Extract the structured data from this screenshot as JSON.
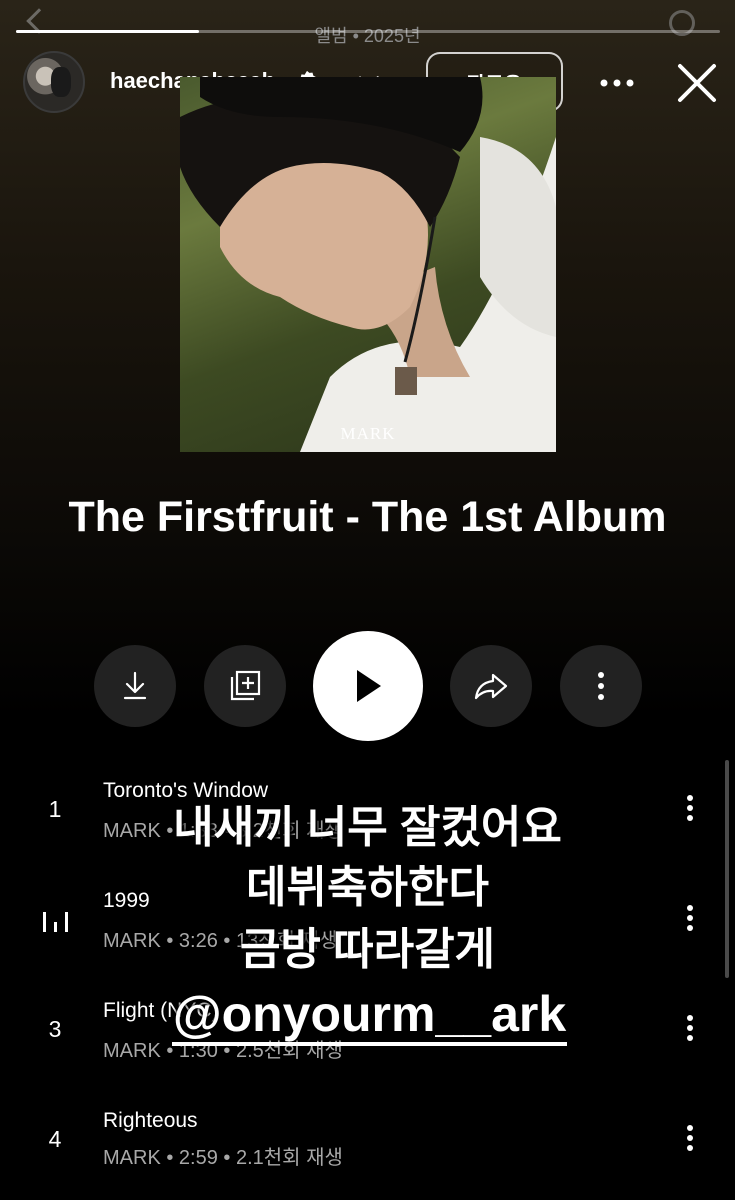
{
  "top": {
    "subtitle": "앨범 • 2025년"
  },
  "story": {
    "progress": 0.26,
    "username": "haechanahceah",
    "time_ago": "1시간",
    "follow_label": "팔로우"
  },
  "album": {
    "art_text": "MARK",
    "title": "The Firstfruit - The 1st Album"
  },
  "actions": [
    "download-icon",
    "add-to-library-icon",
    "play-icon",
    "share-icon",
    "more-icon"
  ],
  "tracks": [
    {
      "num": "1",
      "title": "Toronto's Window",
      "meta": "MARK • 1:38 • 3.2천회 재생",
      "playing": false
    },
    {
      "num": "",
      "title": "1999",
      "meta": "MARK • 3:26 • 13천회 재생",
      "playing": true
    },
    {
      "num": "3",
      "title": "Flight (NYC)",
      "meta": "MARK • 1:30 • 2.5천회 재생",
      "playing": false
    },
    {
      "num": "4",
      "title": "Righteous",
      "meta": "MARK • 2:59 • 2.1천회 재생",
      "playing": false
    }
  ],
  "overlay": {
    "line1": "내새끼 너무 잘컸어요",
    "line2": "데뷔축하한다",
    "line3": "금방 따라갈게",
    "mention": "@onyourm__ark"
  },
  "colors": {
    "background": "#000000",
    "button_bg": "#222222",
    "play_bg": "#ffffff",
    "meta_text": "#a8a8a8",
    "verified": "#ffffff"
  }
}
